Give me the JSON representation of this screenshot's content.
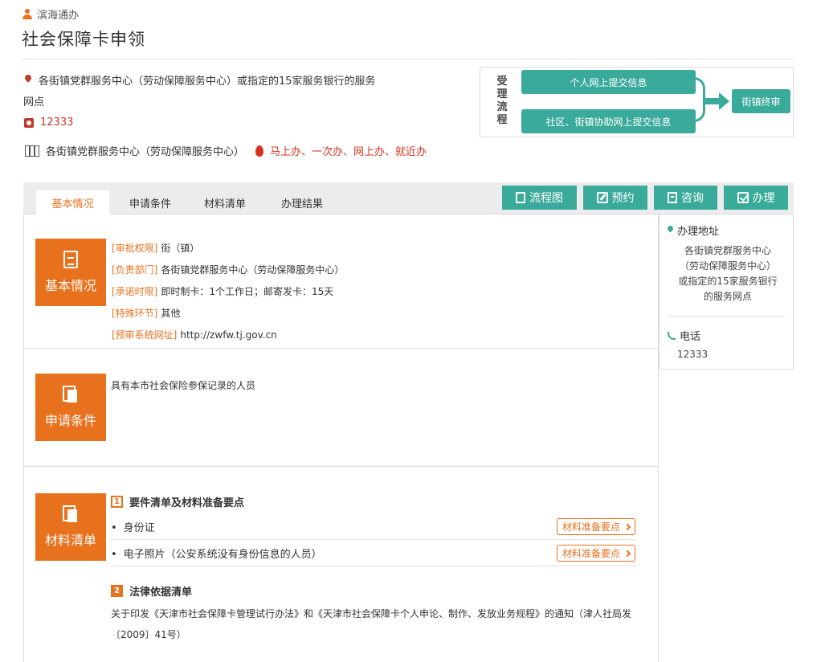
{
  "header": {
    "brand": "滨海通办",
    "title": "社会保障卡申领"
  },
  "info": {
    "address_line1": "各街镇党群服务中心（劳动保障服务中心）或指定的15家服务银行的服务",
    "address_line2": "网点",
    "phone": "12333",
    "location": "各街镇党群服务中心（劳动保障服务中心）",
    "service_tags": "马上办、一次办、网上办、就近办"
  },
  "process": {
    "label": "受理流程",
    "step_a": "个人网上提交信息",
    "step_b": "社区、街镇协助网上提交信息",
    "step_final": "街镇终审"
  },
  "tabs": [
    {
      "label": "基本情况"
    },
    {
      "label": "申请条件"
    },
    {
      "label": "材料清单"
    },
    {
      "label": "办理结果"
    }
  ],
  "actions": {
    "flowchart": "流程图",
    "book": "预约",
    "consult": "咨询",
    "handle": "办理"
  },
  "basic": {
    "section_label": "基本情况",
    "fields": [
      {
        "key": "[审批权限]",
        "value": "街（镇）"
      },
      {
        "key": "[负责部门]",
        "value": "各街镇党群服务中心（劳动保障服务中心）"
      },
      {
        "key": "[承诺时限]",
        "value": "即时制卡：1个工作日；邮寄发卡：15天"
      },
      {
        "key": "[特殊环节]",
        "value": "其他"
      },
      {
        "key": "[预审系统网址]",
        "value": "http://zwfw.tj.gov.cn"
      }
    ]
  },
  "conditions": {
    "section_label": "申请条件",
    "text": "具有本市社会保险参保记录的人员"
  },
  "materials": {
    "section_label": "材料清单",
    "list_badge": "1",
    "list_heading": "要件清单及材料准备要点",
    "items": [
      {
        "bullet": "•",
        "name": "身份证",
        "tip": "材料准备要点"
      },
      {
        "bullet": "•",
        "name": "电子照片（公安系统没有身份信息的人员）",
        "tip": "材料准备要点"
      }
    ],
    "law_badge": "2",
    "law_heading": "法律依据清单",
    "law_text": "关于印发《天津市社会保障卡管理试行办法》和《天津市社会保障卡个人申论、制作、发放业务规程》的通知（津人社局发〔2009〕41号）"
  },
  "sidebar": {
    "address_heading": "办理地址",
    "address": "各街镇党群服务中心（劳动保障服务中心）或指定的15家服务银行的服务网点",
    "phone_heading": "电话",
    "phone": "12333"
  },
  "colors": {
    "accent": "#e8711d",
    "teal": "#3aaa9b",
    "red": "#d9331f"
  }
}
